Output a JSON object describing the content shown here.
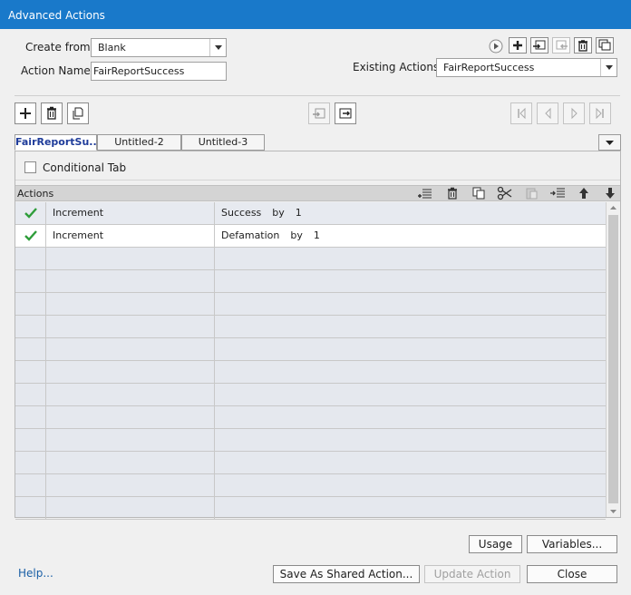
{
  "window": {
    "title": "Advanced Actions"
  },
  "form": {
    "create_from_label": "Create from:",
    "create_from_value": "Blank",
    "action_name_label": "Action Name:",
    "action_name_value": "FairReportSuccess",
    "existing_actions_label": "Existing Actions:",
    "existing_actions_value": "FairReportSuccess"
  },
  "tabs": [
    {
      "label": "FairReportSu...",
      "active": true
    },
    {
      "label": "Untitled-2",
      "active": false
    },
    {
      "label": "Untitled-3",
      "active": false
    }
  ],
  "conditional_tab": {
    "label": "Conditional Tab",
    "checked": false
  },
  "actions_panel": {
    "header": "Actions",
    "rows": [
      {
        "checked": true,
        "action": "Increment",
        "target": "Success",
        "by_label": "by",
        "amount": "1"
      },
      {
        "checked": true,
        "action": "Increment",
        "target": "Defamation",
        "by_label": "by",
        "amount": "1"
      }
    ],
    "empty_row_count": 12
  },
  "buttons": {
    "usage": "Usage",
    "variables": "Variables...",
    "help": "Help...",
    "save_shared": "Save As Shared Action...",
    "update_action": "Update Action",
    "close": "Close"
  },
  "colors": {
    "titlebar": "#1979ca",
    "check": "#2e9d3a",
    "active_tab_text": "#1f3c9a"
  }
}
